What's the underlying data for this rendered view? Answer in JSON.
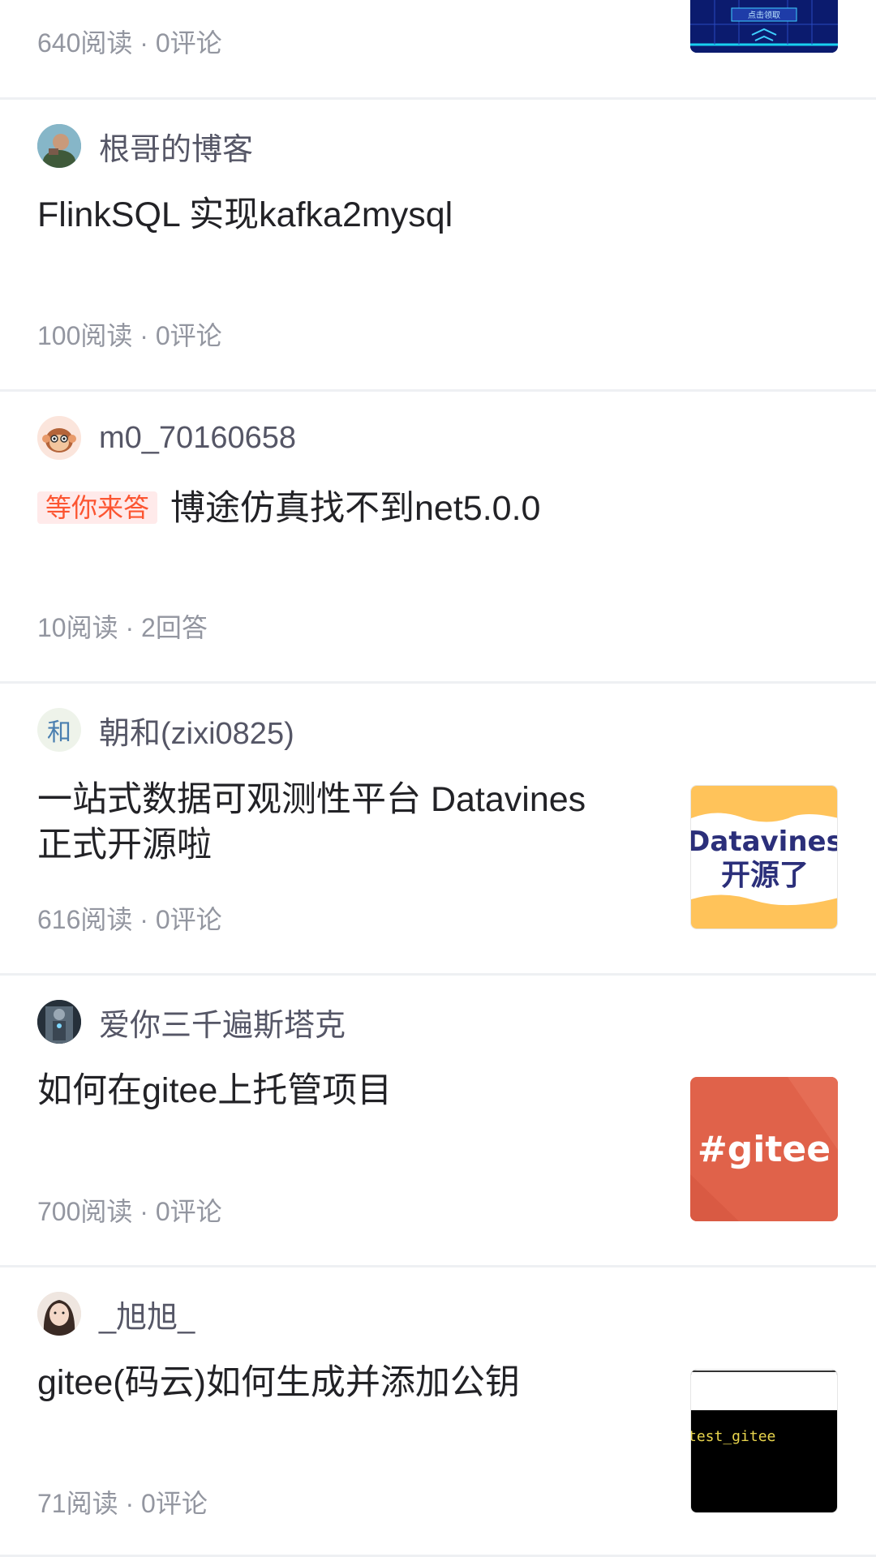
{
  "feed": {
    "items": [
      {
        "meta": "640阅读 · 0评论",
        "thumb": {
          "label": "点击领取",
          "bg": "#0b1b6e"
        }
      },
      {
        "author": "根哥的博客",
        "avatar_icon": "person-avatar-icon",
        "title": "FlinkSQL 实现kafka2mysql",
        "meta": "100阅读 · 0评论"
      },
      {
        "author": "m0_70160658",
        "avatar_icon": "monkey-avatar-icon",
        "tag": "等你来答",
        "title": "博途仿真找不到net5.0.0",
        "meta": "10阅读 · 2回答"
      },
      {
        "author": "朝和(zixi0825)",
        "avatar_icon": "text-avatar-icon",
        "avatar_text": "和",
        "title": "一站式数据可观测性平台 Datavines 正式开源啦",
        "meta": "616阅读 · 0评论",
        "thumb": {
          "line1": "Datavines",
          "line2": "开源了",
          "bg": "#ffffff",
          "accent": "#ffc35a"
        }
      },
      {
        "author": "爱你三千遍斯塔克",
        "avatar_icon": "ironman-avatar-icon",
        "title": "如何在gitee上托管项目",
        "meta": "700阅读 · 0评论",
        "thumb": {
          "label": "#gitee",
          "bg": "#e0624a"
        }
      },
      {
        "author": "_旭旭_",
        "avatar_icon": "girl-avatar-icon",
        "title": "gitee(码云)如何生成并添加公钥",
        "meta": "71阅读 · 0评论",
        "thumb": {
          "label": "test_gitee",
          "bg": "#000000"
        }
      }
    ]
  },
  "colors": {
    "text_primary": "#222226",
    "text_secondary": "#555666",
    "meta": "#9396a0",
    "tag_bg": "#ffeaea",
    "tag_text": "#fc5531",
    "divider": "#eef0f3"
  }
}
